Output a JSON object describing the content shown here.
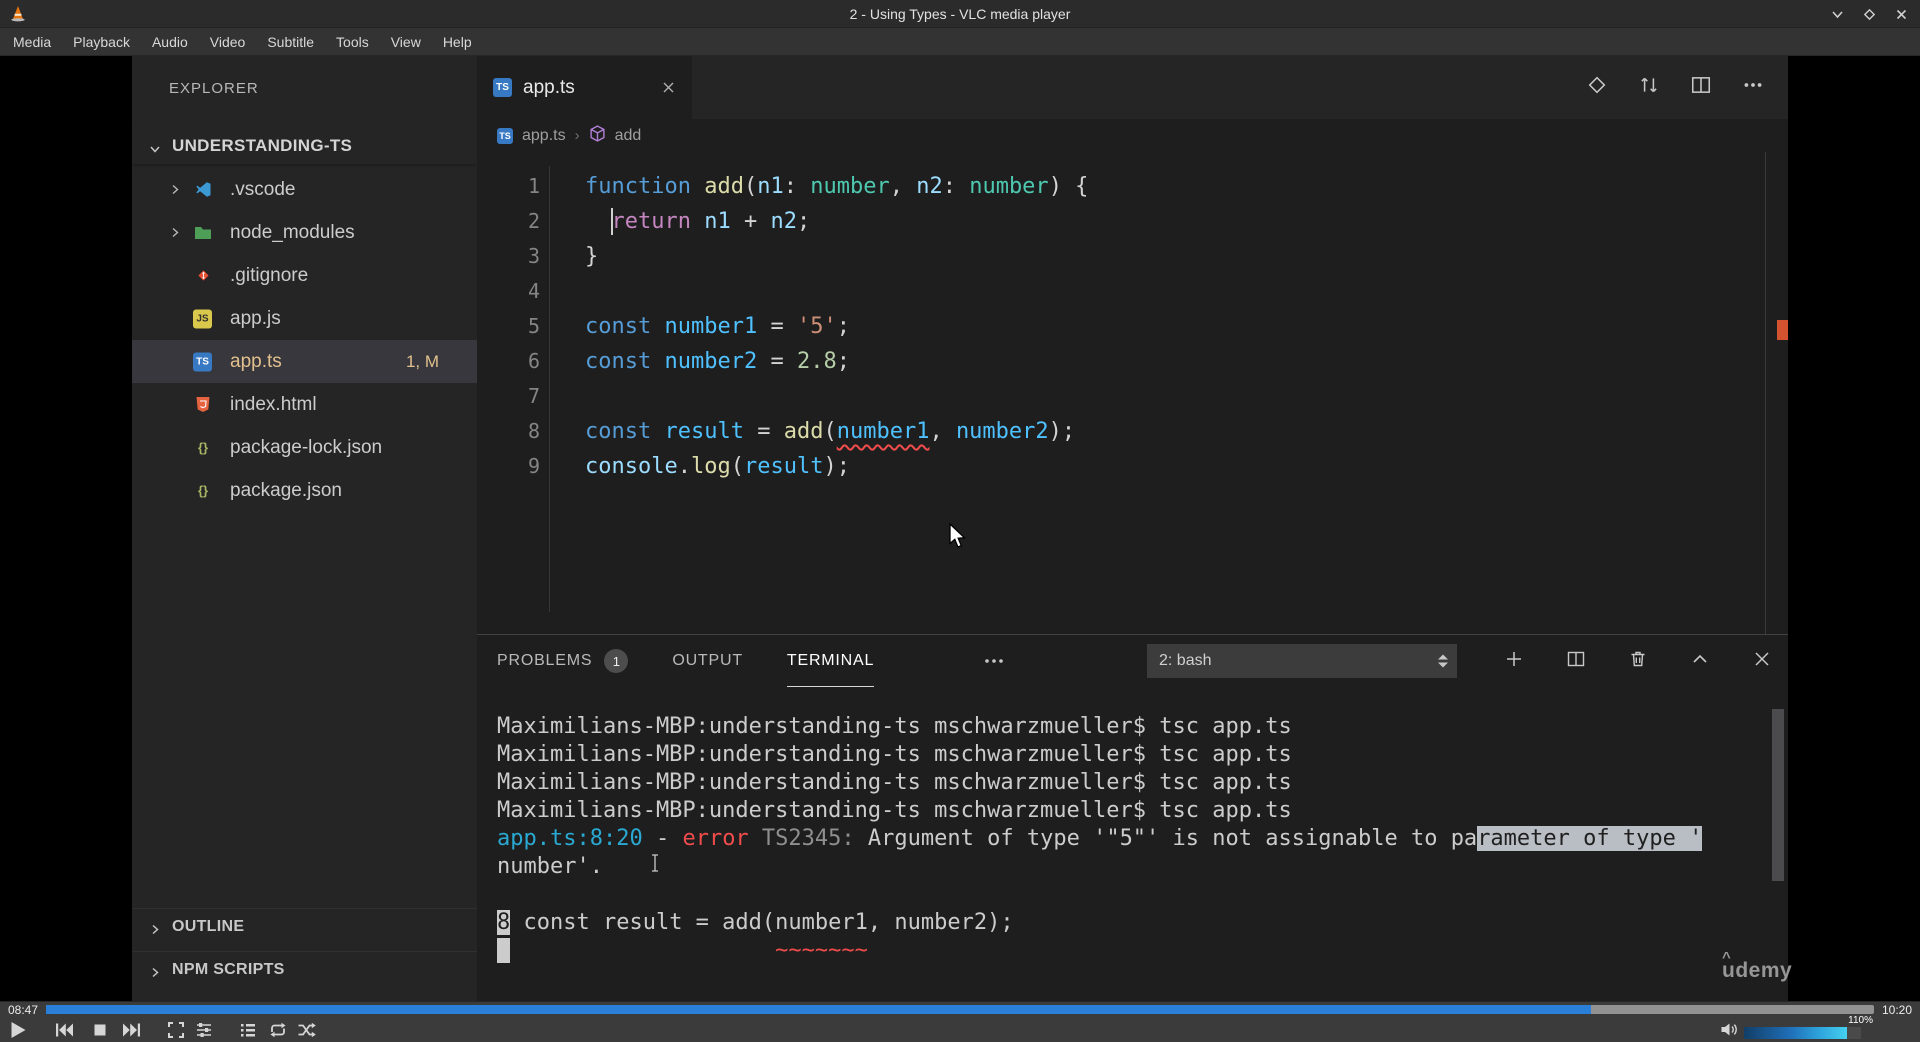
{
  "vlc": {
    "title": "2 - Using Types - VLC media player",
    "menu": [
      "Media",
      "Playback",
      "Audio",
      "Video",
      "Subtitle",
      "Tools",
      "View",
      "Help"
    ],
    "seek": {
      "elapsed": "08:47",
      "total": "10:20",
      "progress_percent": 84.5,
      "bar_color": "#2a7fd9"
    },
    "volume": {
      "label": "110%",
      "fill_percent": 88
    }
  },
  "video": {
    "watermark": "udemy",
    "vscode": {
      "explorer": {
        "title": "EXPLORER",
        "root": "UNDERSTANDING-TS",
        "icon_colors": {
          "vscode-folder-icon": "#3C99D4",
          "folder-icon": "#4F9E58",
          "git-icon": "#E84E31",
          "js-icon": "#D9C84B",
          "ts-icon": "#3779C2",
          "html-icon": "#E5633F",
          "json-icon": "#A9B665"
        },
        "files": [
          {
            "label": ".vscode",
            "icon": "vscode-folder-icon",
            "folder": true
          },
          {
            "label": "node_modules",
            "icon": "folder-icon",
            "folder": true
          },
          {
            "label": ".gitignore",
            "icon": "git-icon"
          },
          {
            "label": "app.js",
            "icon": "js-icon"
          },
          {
            "label": "app.ts",
            "icon": "ts-icon",
            "selected": true,
            "badge": "1, M"
          },
          {
            "label": "index.html",
            "icon": "html-icon"
          },
          {
            "label": "package-lock.json",
            "icon": "json-icon"
          },
          {
            "label": "package.json",
            "icon": "json-icon"
          }
        ],
        "sections": [
          "OUTLINE",
          "NPM SCRIPTS"
        ]
      },
      "editor": {
        "tab_label": "app.ts",
        "breadcrumb": [
          "app.ts",
          "add"
        ],
        "cursor": {
          "line": 2,
          "col": 3
        },
        "palette": {
          "kw": "#569CD6",
          "fn": "#DCDCAA",
          "var": "#9CDCFE",
          "cvar": "#4FC1FF",
          "type": "#4EC9B0",
          "ctrl": "#C586C0",
          "str": "#CE9178",
          "num": "#B5CEA8",
          "fg": "#D4D4D4"
        },
        "lines": [
          {
            "num": 1,
            "tokens": [
              {
                "t": "function",
                "c": "kw"
              },
              {
                "t": " ",
                "c": "fg"
              },
              {
                "t": "add",
                "c": "fn"
              },
              {
                "t": "(",
                "c": "fg"
              },
              {
                "t": "n1",
                "c": "var"
              },
              {
                "t": ": ",
                "c": "fg"
              },
              {
                "t": "number",
                "c": "type"
              },
              {
                "t": ", ",
                "c": "fg"
              },
              {
                "t": "n2",
                "c": "var"
              },
              {
                "t": ": ",
                "c": "fg"
              },
              {
                "t": "number",
                "c": "type"
              },
              {
                "t": ") {",
                "c": "fg"
              }
            ]
          },
          {
            "num": 2,
            "tokens": [
              {
                "t": "  ",
                "c": "fg"
              },
              {
                "t": "return",
                "c": "ctrl"
              },
              {
                "t": " ",
                "c": "fg"
              },
              {
                "t": "n1",
                "c": "var"
              },
              {
                "t": " + ",
                "c": "fg"
              },
              {
                "t": "n2",
                "c": "var"
              },
              {
                "t": ";",
                "c": "fg"
              }
            ]
          },
          {
            "num": 3,
            "tokens": [
              {
                "t": "}",
                "c": "fg"
              }
            ]
          },
          {
            "num": 4,
            "tokens": []
          },
          {
            "num": 5,
            "tokens": [
              {
                "t": "const",
                "c": "kw"
              },
              {
                "t": " ",
                "c": "fg"
              },
              {
                "t": "number1",
                "c": "cvar"
              },
              {
                "t": " = ",
                "c": "fg"
              },
              {
                "t": "'5'",
                "c": "str"
              },
              {
                "t": ";",
                "c": "fg"
              }
            ]
          },
          {
            "num": 6,
            "tokens": [
              {
                "t": "const",
                "c": "kw"
              },
              {
                "t": " ",
                "c": "fg"
              },
              {
                "t": "number2",
                "c": "cvar"
              },
              {
                "t": " = ",
                "c": "fg"
              },
              {
                "t": "2.8",
                "c": "num"
              },
              {
                "t": ";",
                "c": "fg"
              }
            ]
          },
          {
            "num": 7,
            "tokens": []
          },
          {
            "num": 8,
            "tokens": [
              {
                "t": "const",
                "c": "kw"
              },
              {
                "t": " ",
                "c": "fg"
              },
              {
                "t": "result",
                "c": "cvar"
              },
              {
                "t": " = ",
                "c": "fg"
              },
              {
                "t": "add",
                "c": "fn"
              },
              {
                "t": "(",
                "c": "fg"
              },
              {
                "t": "number1",
                "c": "cvar",
                "err": true
              },
              {
                "t": ", ",
                "c": "fg"
              },
              {
                "t": "number2",
                "c": "cvar"
              },
              {
                "t": ");",
                "c": "fg"
              }
            ]
          },
          {
            "num": 9,
            "tokens": [
              {
                "t": "console",
                "c": "var"
              },
              {
                "t": ".",
                "c": "fg"
              },
              {
                "t": "log",
                "c": "fn"
              },
              {
                "t": "(",
                "c": "fg"
              },
              {
                "t": "result",
                "c": "cvar"
              },
              {
                "t": ");",
                "c": "fg"
              }
            ]
          }
        ]
      },
      "panel": {
        "tabs": [
          {
            "label": "PROBLEMS",
            "badge": "1"
          },
          {
            "label": "OUTPUT"
          },
          {
            "label": "TERMINAL",
            "active": true
          }
        ],
        "shell_select": "2: bash",
        "terminal_palette": {
          "fg": "#CCCCCC",
          "cyan": "#2AA9D2",
          "red": "#F14C4C",
          "dim": "#8F8F8F"
        },
        "terminal_lines": [
          {
            "spans": [
              {
                "t": "Maximilians-MBP:understanding-ts mschwarzmueller$ tsc app.ts",
                "c": "fg"
              }
            ]
          },
          {
            "spans": [
              {
                "t": "Maximilians-MBP:understanding-ts mschwarzmueller$ tsc app.ts",
                "c": "fg"
              }
            ]
          },
          {
            "spans": [
              {
                "t": "Maximilians-MBP:understanding-ts mschwarzmueller$ tsc app.ts",
                "c": "fg"
              }
            ]
          },
          {
            "spans": [
              {
                "t": "Maximilians-MBP:understanding-ts mschwarzmueller$ tsc app.ts",
                "c": "fg"
              }
            ]
          },
          {
            "spans": [
              {
                "t": "app.ts:8:20",
                "c": "cyan"
              },
              {
                "t": " - ",
                "c": "fg"
              },
              {
                "t": "error",
                "c": "red"
              },
              {
                "t": " TS2345: ",
                "c": "dim"
              },
              {
                "t": "Argument of type '\"5\"' is not assignable to pa",
                "c": "fg"
              },
              {
                "t": "rameter of type '",
                "c": "fg",
                "sel": true
              }
            ]
          },
          {
            "spans": [
              {
                "t": "number'.",
                "c": "fg"
              }
            ]
          },
          {
            "spans": []
          },
          {
            "spans": [
              {
                "t": "8",
                "inv": true
              },
              {
                "t": " const result = add(number1, number2);",
                "c": "fg"
              }
            ]
          },
          {
            "spans": [
              {
                "t": " ",
                "inv": true
              },
              {
                "t": "                    ",
                "c": "fg"
              },
              {
                "t": "~~~~~~~",
                "c": "red"
              }
            ]
          }
        ]
      }
    }
  }
}
